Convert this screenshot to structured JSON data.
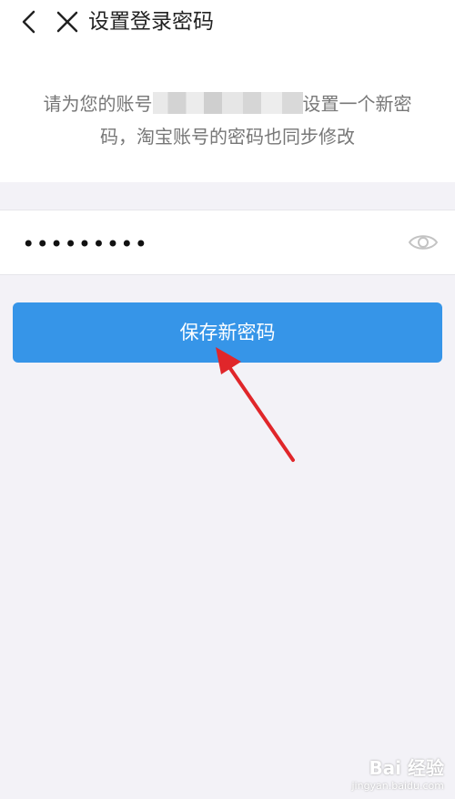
{
  "header": {
    "title": "设置登录密码",
    "back_icon": "chevron-left-icon",
    "close_icon": "close-icon"
  },
  "notice": {
    "prefix": "请为您的账号",
    "suffix": "设置一个新密",
    "line2": "码，淘宝账号的密码也同步修改"
  },
  "password": {
    "value": "•••••••••",
    "visibility_icon": "eye-icon"
  },
  "save_button": {
    "label": "保存新密码",
    "color": "#3695e8"
  },
  "watermark": {
    "main": "Bai 经验",
    "sub": "jingyan.baidu.com"
  },
  "colors": {
    "background": "#f3f2f7",
    "arrow": "#e0262a"
  }
}
